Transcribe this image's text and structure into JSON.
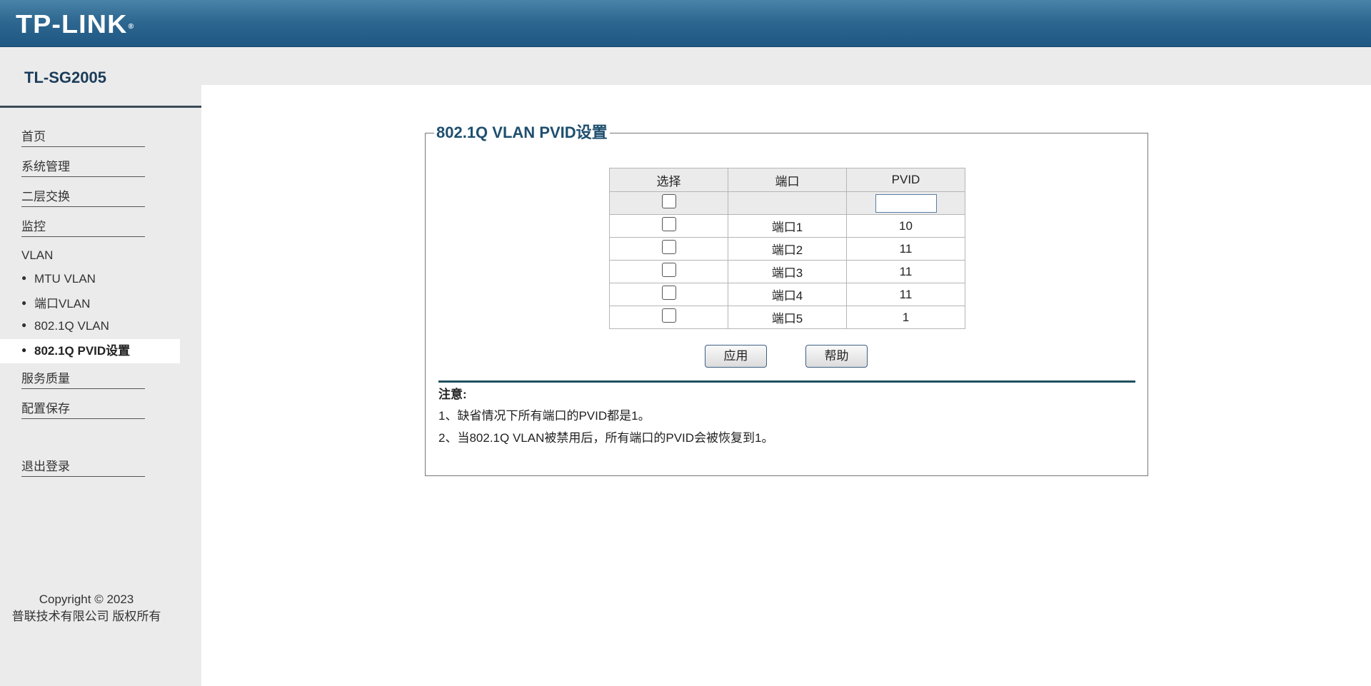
{
  "header": {
    "logo_text": "TP-LINK",
    "logo_mark": "®"
  },
  "sidebar": {
    "model": "TL-SG2005",
    "menu": [
      {
        "label": "首页"
      },
      {
        "label": "系统管理"
      },
      {
        "label": "二层交换"
      },
      {
        "label": "监控"
      }
    ],
    "vlan_label": "VLAN",
    "vlan_items": [
      {
        "label": "MTU VLAN"
      },
      {
        "label": "端口VLAN"
      },
      {
        "label": "802.1Q VLAN"
      },
      {
        "label": "802.1Q PVID设置",
        "active": true
      }
    ],
    "menu_after": [
      {
        "label": "服务质量"
      },
      {
        "label": "配置保存"
      }
    ],
    "logout": "退出登录",
    "copyright_line1": "Copyright © 2023",
    "copyright_line2": "普联技术有限公司 版权所有"
  },
  "panel": {
    "title": "802.1Q VLAN PVID设置",
    "columns": [
      "选择",
      "端口",
      "PVID"
    ],
    "pvid_input_value": "",
    "rows": [
      {
        "port": "端口1",
        "pvid": "10"
      },
      {
        "port": "端口2",
        "pvid": "11"
      },
      {
        "port": "端口3",
        "pvid": "11"
      },
      {
        "port": "端口4",
        "pvid": "11"
      },
      {
        "port": "端口5",
        "pvid": "1"
      }
    ],
    "apply_label": "应用",
    "help_label": "帮助",
    "note_title": "注意:",
    "notes": [
      "1、缺省情况下所有端口的PVID都是1。",
      "2、当802.1Q VLAN被禁用后，所有端口的PVID会被恢复到1。"
    ]
  }
}
